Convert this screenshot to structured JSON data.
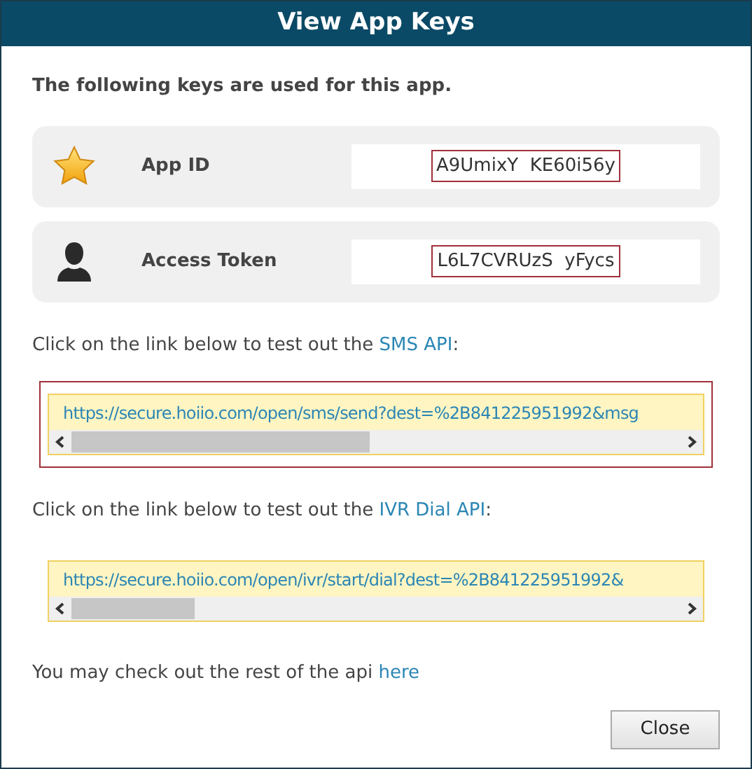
{
  "window": {
    "title": "View App Keys"
  },
  "intro": "The following keys are used for this app.",
  "keys": [
    {
      "kind": "star",
      "label": "App ID",
      "value": "A9UmixY  KE60i56y",
      "highlighted": true
    },
    {
      "kind": "person",
      "label": "Access Token",
      "value": "L6L7CVRUzS  yFycs",
      "highlighted": true
    }
  ],
  "api_links": [
    {
      "prompt": "Click on the link below to test out the ",
      "link": "SMS API",
      "suffix": ":",
      "url": "https://secure.hoiio.com/open/sms/send?dest=%2B841225951992&msg",
      "highlighted": true
    },
    {
      "prompt": "Click on the link below to test out the ",
      "link": "IVR Dial API",
      "suffix": ":",
      "url": "https://secure.hoiio.com/open/ivr/start/dial?dest=%2B841225951992&",
      "highlighted": false
    }
  ],
  "footer": {
    "text": "You may check out the rest of the api ",
    "link": "here"
  },
  "buttons": [
    "Close"
  ]
}
